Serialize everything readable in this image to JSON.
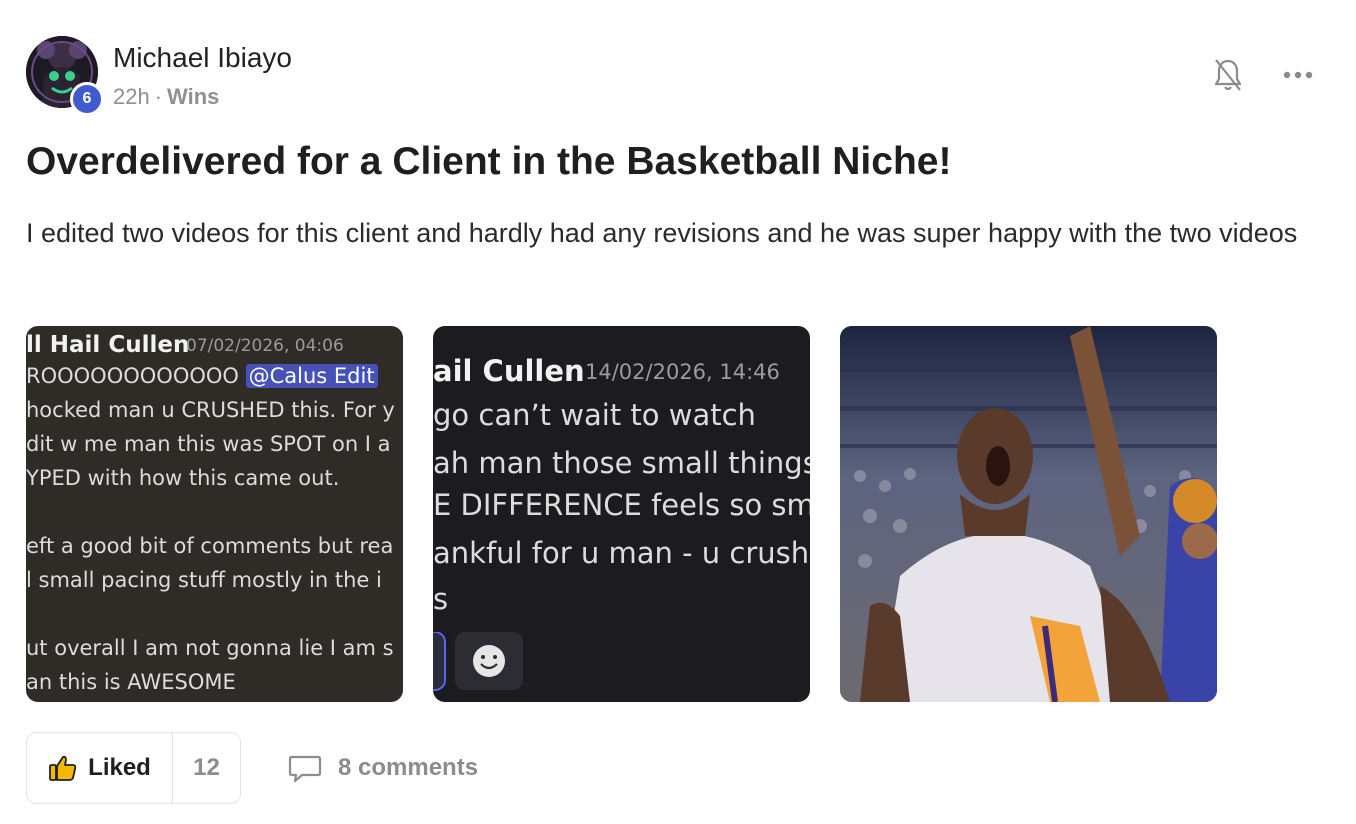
{
  "post": {
    "author": {
      "name": "Michael Ibiayo",
      "level": "6"
    },
    "time": "22h",
    "separator": "·",
    "category": "Wins",
    "title": "Overdelivered for a Client in the Basketball Niche!",
    "body": "I edited two videos for this client and hardly had any revisions and he was super happy with the two videos"
  },
  "attachments": {
    "image1": {
      "username": "ll Hail Cullen",
      "timestamp": "07/02/2026, 04:06",
      "line1_prefix": "ROOOOOOOOOOOO ",
      "mention": "@Calus Edit",
      "lines": [
        "hocked man u CRUSHED this. For y",
        "dit w me man this was SPOT on I a",
        "YPED with how this came out.",
        "eft a good bit of comments but rea",
        "l small pacing stuff mostly in the i",
        "ut overall I am not gonna lie I am s",
        "an this is AWESOME"
      ]
    },
    "image2": {
      "username": "ail Cullen",
      "timestamp": "14/02/2026, 14:46",
      "lines": [
        "go can’t wait to watch",
        "ah man those small things m",
        "E DIFFERENCE feels so sm",
        "ankful for u man - u crushe",
        "s"
      ]
    },
    "image3": {
      "alt": "basketball player celebrating"
    }
  },
  "actions": {
    "like_label": "Liked",
    "like_count": "12",
    "comments_label": "8 comments"
  },
  "colors": {
    "badge": "#3f5bcf",
    "mention": "#4752b8",
    "text_primary": "#1f1f1f",
    "text_muted": "#8c8c8c",
    "like_icon": "#f5b800"
  },
  "icons": [
    "bell-icon",
    "more-icon",
    "thumbs-up-icon",
    "comment-icon",
    "emoji-icon"
  ]
}
